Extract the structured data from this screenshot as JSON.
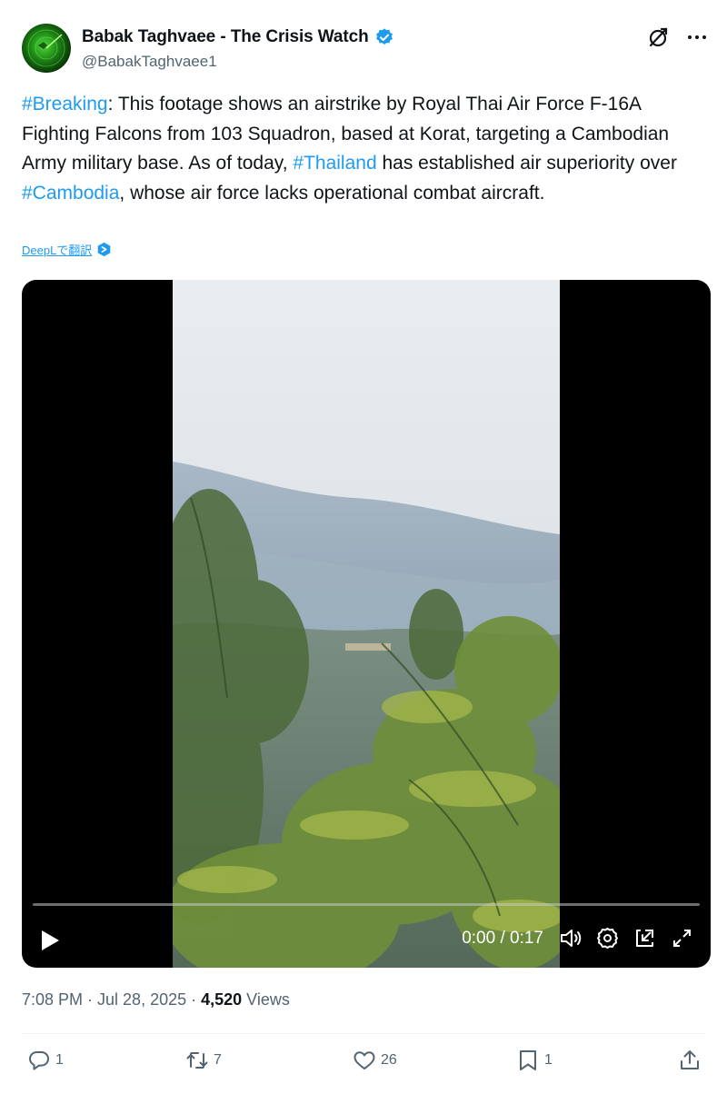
{
  "author": {
    "display_name": "Babak Taghvaee - The Crisis Watch",
    "handle": "@BabakTaghvaee1"
  },
  "tweet": {
    "segments": [
      {
        "text": "#Breaking",
        "type": "hashtag"
      },
      {
        "text": ": This footage shows an airstrike by Royal Thai Air Force F-16A Fighting Falcons from 103 Squadron, based at Korat, targeting a Cambodian Army military base. As of today, ",
        "type": "text"
      },
      {
        "text": "#Thailand",
        "type": "hashtag"
      },
      {
        "text": " has established air superiority over ",
        "type": "text"
      },
      {
        "text": "#Cambodia",
        "type": "hashtag"
      },
      {
        "text": ", whose air force lacks operational combat aircraft.",
        "type": "text"
      }
    ],
    "translate_label": "DeepLで翻訳"
  },
  "video": {
    "time": "0:00 / 0:17",
    "progress": 0.0
  },
  "meta": {
    "timestamp": "7:08 PM · Jul 28, 2025 · ",
    "views_count": "4,520",
    "views_label": " Views"
  },
  "actions": {
    "replies": "1",
    "reposts": "7",
    "likes": "26",
    "bookmarks": "1"
  },
  "colors": {
    "hashtag": "#1d9bf0",
    "verified": "#1d9bf0",
    "secondary_text": "#536471"
  },
  "icons": [
    "verified-icon",
    "grok-icon",
    "more-icon",
    "deepl-icon",
    "play-icon",
    "volume-icon",
    "settings-icon",
    "pip-icon",
    "fullscreen-icon",
    "reply-icon",
    "repost-icon",
    "like-icon",
    "bookmark-icon",
    "share-icon"
  ]
}
